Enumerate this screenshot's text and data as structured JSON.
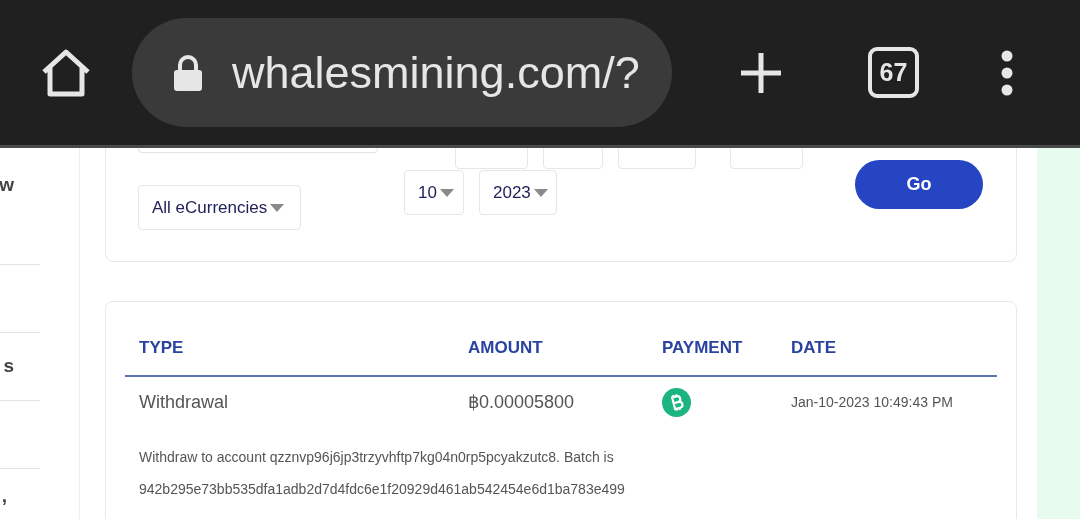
{
  "browser": {
    "url": "whalesmining.com/?",
    "tab_count": "67"
  },
  "sidebar": {
    "items": [
      {
        "label": "w"
      },
      {
        "label": "s"
      },
      {
        "label": ","
      }
    ]
  },
  "filter": {
    "currency_select": {
      "value": "All eCurrencies"
    },
    "to": [
      "10",
      "2023"
    ],
    "go_button": "Go"
  },
  "table": {
    "columns": [
      "TYPE",
      "AMOUNT",
      "PAYMENT",
      "DATE"
    ],
    "rows": [
      {
        "type": "Withdrawal",
        "amount": "฿0.00005800",
        "date": "Jan-10-2023 10:49:43 PM",
        "description": "Withdraw to account qzznvp96j6jp3trzyvhftp7kg04n0rp5pcyakzutc8. Batch is 942b295e73bb535dfa1adb2d7d4fdc6e1f20929d461ab542454e6d1ba783e499"
      }
    ]
  }
}
